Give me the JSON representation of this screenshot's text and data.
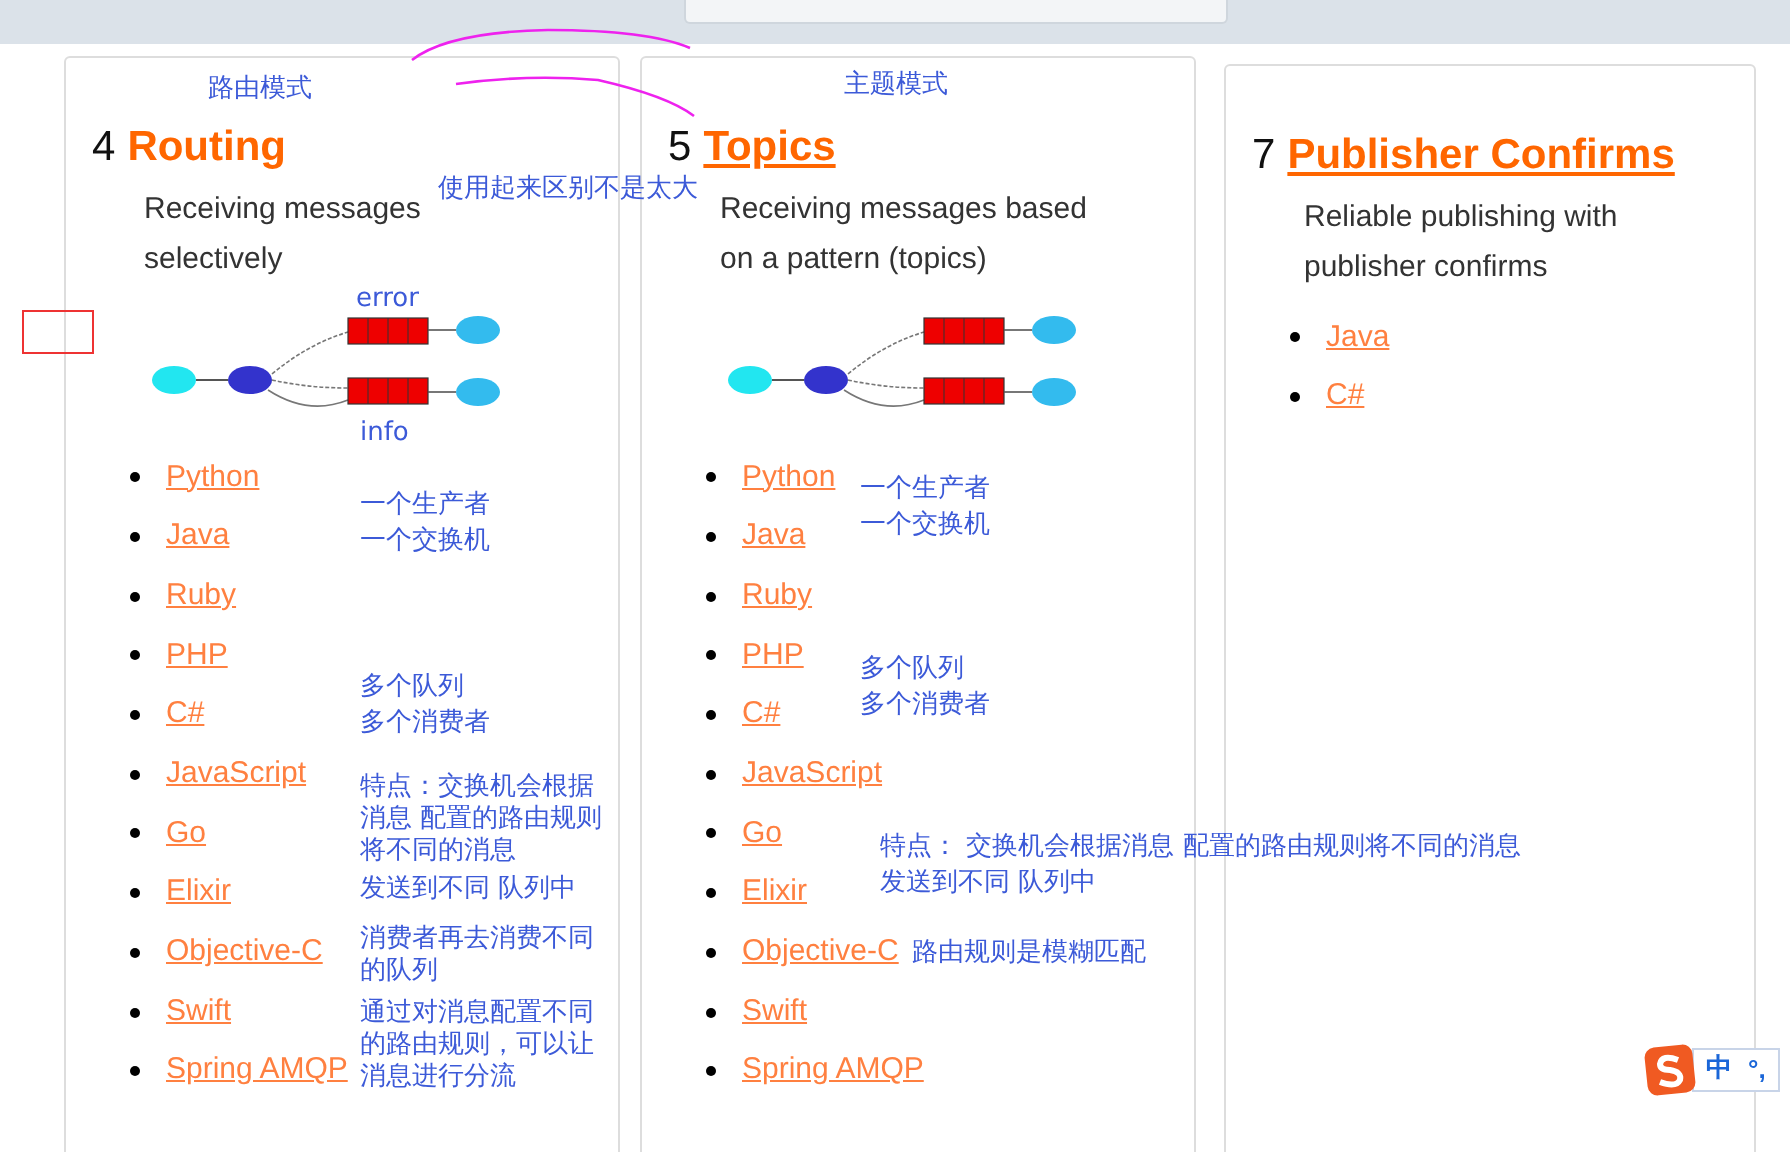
{
  "tutorials": [
    {
      "number": "4",
      "title": "Routing",
      "underlined": false,
      "description": "Receiving messages selectively",
      "kind": "routing",
      "links": [
        "Python",
        "Java",
        "Ruby",
        "PHP",
        "C#",
        "JavaScript",
        "Go",
        "Elixir",
        "Objective-C",
        "Swift",
        "Spring AMQP"
      ]
    },
    {
      "number": "5",
      "title": "Topics",
      "underlined": true,
      "description": "Receiving messages based on a pattern (topics)",
      "kind": "topics",
      "links": [
        "Python",
        "Java",
        "Ruby",
        "PHP",
        "C#",
        "JavaScript",
        "Go",
        "Elixir",
        "Objective-C",
        "Swift",
        "Spring AMQP"
      ]
    },
    {
      "number": "7",
      "title": "Publisher Confirms",
      "underlined": true,
      "description": "Reliable publishing with publisher confirms",
      "kind": "plain",
      "links": [
        "Java",
        "C#"
      ]
    }
  ],
  "annotations": [
    {
      "text": "路由模式"
    },
    {
      "text": "主题模式"
    },
    {
      "text": "使用起来区别不是太大"
    },
    {
      "text": "error"
    },
    {
      "text": "info"
    },
    {
      "text": "一个生产者"
    },
    {
      "text": "一个交换机"
    },
    {
      "text": "多个队列"
    },
    {
      "text": "多个消费者"
    },
    {
      "text": "特点：交换机会根据消息 配置的路由规则将不同的消息"
    },
    {
      "text": "发送到不同 队列中"
    },
    {
      "text": "消费者再去消费不同的队列"
    },
    {
      "text": "通过对消息配置不同的路由规则，可以让消息进行分流"
    },
    {
      "text": "一个生产者"
    },
    {
      "text": "一个交换机"
    },
    {
      "text": "多个队列"
    },
    {
      "text": "多个消费者"
    },
    {
      "text": "特点： 交换机会根据消息 配置的路由规则将不同的消息"
    },
    {
      "text": "发送到不同 队列中"
    },
    {
      "text": "路由规则是模糊匹配"
    }
  ],
  "ime": {
    "mode": "中",
    "punctuation": "°,"
  }
}
